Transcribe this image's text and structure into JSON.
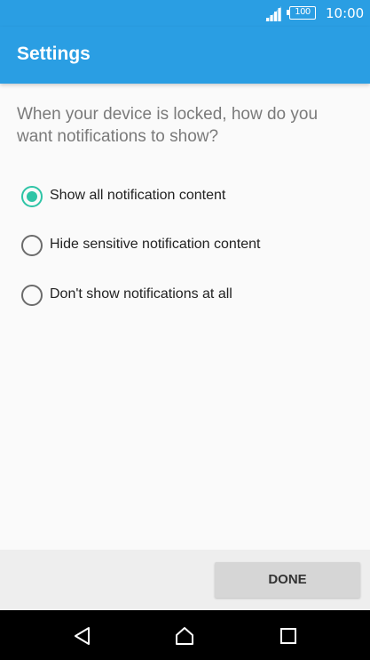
{
  "status_bar": {
    "battery_level": "100",
    "time": "10:00",
    "icons": [
      "signal-icon",
      "battery-icon"
    ]
  },
  "app_bar": {
    "title": "Settings"
  },
  "prompt": "When your device is locked, how do you want notifications to show?",
  "options": [
    {
      "label": "Show all notification content",
      "selected": true
    },
    {
      "label": "Hide sensitive notification content",
      "selected": false
    },
    {
      "label": "Don't show notifications at all",
      "selected": false
    }
  ],
  "footer": {
    "done_label": "DONE"
  },
  "nav_bar": {
    "icons": [
      "back-icon",
      "home-icon",
      "recents-icon"
    ]
  },
  "colors": {
    "primary": "#2a9ee3",
    "accent": "#2ec4a6",
    "background": "#fafafa"
  }
}
